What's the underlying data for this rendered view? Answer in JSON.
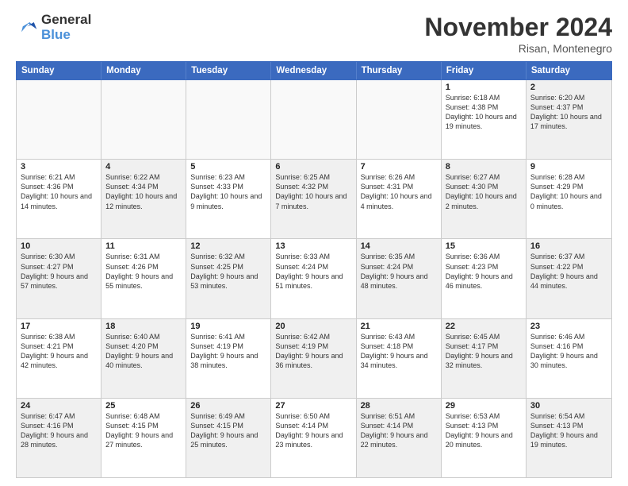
{
  "logo": {
    "line1": "General",
    "line2": "Blue"
  },
  "title": "November 2024",
  "location": "Risan, Montenegro",
  "days_of_week": [
    "Sunday",
    "Monday",
    "Tuesday",
    "Wednesday",
    "Thursday",
    "Friday",
    "Saturday"
  ],
  "weeks": [
    [
      {
        "day": "",
        "text": "",
        "empty": true
      },
      {
        "day": "",
        "text": "",
        "empty": true
      },
      {
        "day": "",
        "text": "",
        "empty": true
      },
      {
        "day": "",
        "text": "",
        "empty": true
      },
      {
        "day": "",
        "text": "",
        "empty": true
      },
      {
        "day": "1",
        "text": "Sunrise: 6:18 AM\nSunset: 4:38 PM\nDaylight: 10 hours and 19 minutes."
      },
      {
        "day": "2",
        "text": "Sunrise: 6:20 AM\nSunset: 4:37 PM\nDaylight: 10 hours and 17 minutes.",
        "shaded": true
      }
    ],
    [
      {
        "day": "3",
        "text": "Sunrise: 6:21 AM\nSunset: 4:36 PM\nDaylight: 10 hours and 14 minutes."
      },
      {
        "day": "4",
        "text": "Sunrise: 6:22 AM\nSunset: 4:34 PM\nDaylight: 10 hours and 12 minutes.",
        "shaded": true
      },
      {
        "day": "5",
        "text": "Sunrise: 6:23 AM\nSunset: 4:33 PM\nDaylight: 10 hours and 9 minutes."
      },
      {
        "day": "6",
        "text": "Sunrise: 6:25 AM\nSunset: 4:32 PM\nDaylight: 10 hours and 7 minutes.",
        "shaded": true
      },
      {
        "day": "7",
        "text": "Sunrise: 6:26 AM\nSunset: 4:31 PM\nDaylight: 10 hours and 4 minutes."
      },
      {
        "day": "8",
        "text": "Sunrise: 6:27 AM\nSunset: 4:30 PM\nDaylight: 10 hours and 2 minutes.",
        "shaded": true
      },
      {
        "day": "9",
        "text": "Sunrise: 6:28 AM\nSunset: 4:29 PM\nDaylight: 10 hours and 0 minutes."
      }
    ],
    [
      {
        "day": "10",
        "text": "Sunrise: 6:30 AM\nSunset: 4:27 PM\nDaylight: 9 hours and 57 minutes.",
        "shaded": true
      },
      {
        "day": "11",
        "text": "Sunrise: 6:31 AM\nSunset: 4:26 PM\nDaylight: 9 hours and 55 minutes."
      },
      {
        "day": "12",
        "text": "Sunrise: 6:32 AM\nSunset: 4:25 PM\nDaylight: 9 hours and 53 minutes.",
        "shaded": true
      },
      {
        "day": "13",
        "text": "Sunrise: 6:33 AM\nSunset: 4:24 PM\nDaylight: 9 hours and 51 minutes."
      },
      {
        "day": "14",
        "text": "Sunrise: 6:35 AM\nSunset: 4:24 PM\nDaylight: 9 hours and 48 minutes.",
        "shaded": true
      },
      {
        "day": "15",
        "text": "Sunrise: 6:36 AM\nSunset: 4:23 PM\nDaylight: 9 hours and 46 minutes."
      },
      {
        "day": "16",
        "text": "Sunrise: 6:37 AM\nSunset: 4:22 PM\nDaylight: 9 hours and 44 minutes.",
        "shaded": true
      }
    ],
    [
      {
        "day": "17",
        "text": "Sunrise: 6:38 AM\nSunset: 4:21 PM\nDaylight: 9 hours and 42 minutes."
      },
      {
        "day": "18",
        "text": "Sunrise: 6:40 AM\nSunset: 4:20 PM\nDaylight: 9 hours and 40 minutes.",
        "shaded": true
      },
      {
        "day": "19",
        "text": "Sunrise: 6:41 AM\nSunset: 4:19 PM\nDaylight: 9 hours and 38 minutes."
      },
      {
        "day": "20",
        "text": "Sunrise: 6:42 AM\nSunset: 4:19 PM\nDaylight: 9 hours and 36 minutes.",
        "shaded": true
      },
      {
        "day": "21",
        "text": "Sunrise: 6:43 AM\nSunset: 4:18 PM\nDaylight: 9 hours and 34 minutes."
      },
      {
        "day": "22",
        "text": "Sunrise: 6:45 AM\nSunset: 4:17 PM\nDaylight: 9 hours and 32 minutes.",
        "shaded": true
      },
      {
        "day": "23",
        "text": "Sunrise: 6:46 AM\nSunset: 4:16 PM\nDaylight: 9 hours and 30 minutes."
      }
    ],
    [
      {
        "day": "24",
        "text": "Sunrise: 6:47 AM\nSunset: 4:16 PM\nDaylight: 9 hours and 28 minutes.",
        "shaded": true
      },
      {
        "day": "25",
        "text": "Sunrise: 6:48 AM\nSunset: 4:15 PM\nDaylight: 9 hours and 27 minutes."
      },
      {
        "day": "26",
        "text": "Sunrise: 6:49 AM\nSunset: 4:15 PM\nDaylight: 9 hours and 25 minutes.",
        "shaded": true
      },
      {
        "day": "27",
        "text": "Sunrise: 6:50 AM\nSunset: 4:14 PM\nDaylight: 9 hours and 23 minutes."
      },
      {
        "day": "28",
        "text": "Sunrise: 6:51 AM\nSunset: 4:14 PM\nDaylight: 9 hours and 22 minutes.",
        "shaded": true
      },
      {
        "day": "29",
        "text": "Sunrise: 6:53 AM\nSunset: 4:13 PM\nDaylight: 9 hours and 20 minutes."
      },
      {
        "day": "30",
        "text": "Sunrise: 6:54 AM\nSunset: 4:13 PM\nDaylight: 9 hours and 19 minutes.",
        "shaded": true
      }
    ]
  ]
}
